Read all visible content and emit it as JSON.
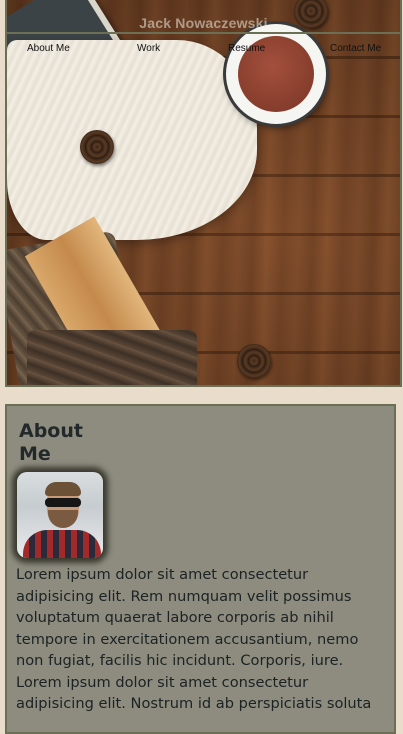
{
  "header": {
    "site_title": "Jack Nowaczewski"
  },
  "nav": {
    "items": [
      {
        "label": "About Me"
      },
      {
        "label": "Work"
      },
      {
        "label": "Resume"
      },
      {
        "label": "Contact Me"
      }
    ]
  },
  "about": {
    "title": "About Me",
    "body": "Lorem ipsum dolor sit amet consectetur adipisicing elit. Rem numquam velit possimus voluptatum quaerat labore corporis ab nihil tempore in exercitationem accusantium, nemo non fugiat, facilis hic incidunt. Corporis, iure. Lorem ipsum dolor sit amet consectetur adipisicing elit. Nostrum id ab perspiciatis soluta"
  },
  "colors": {
    "page_bg": "#e9dccb",
    "panel_bg": "#8d8c7f",
    "border": "#6b6f55",
    "text": "#1c2324"
  }
}
